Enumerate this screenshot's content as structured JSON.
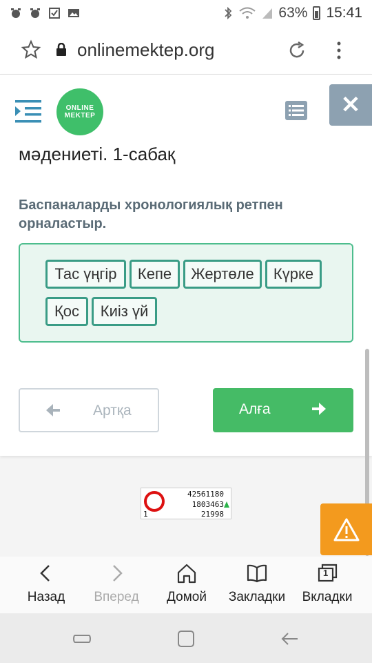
{
  "status": {
    "battery": "63%",
    "time": "15:41",
    "icons": [
      "alarm-icon",
      "alarm-icon",
      "checkbox-icon",
      "image-icon",
      "bluetooth-icon",
      "wifi-icon",
      "signal-icon",
      "battery-icon"
    ]
  },
  "browser": {
    "url": "onlinemektep.org"
  },
  "header": {
    "logo_line1": "ONLINE",
    "logo_line2": "MEKTEP"
  },
  "lesson": {
    "title": "мәдениеті. 1-сабақ",
    "question": "Баспаналарды хронологиялық ретпен орналастыр."
  },
  "chips": [
    "Тас үңгір",
    "Кепе",
    "Жертөле",
    "Күрке",
    "Қос",
    "Киіз үй"
  ],
  "buttons": {
    "back_label": "Артқа",
    "next_label": "Алға"
  },
  "counter": {
    "total": "42561180",
    "today": "1803463",
    "online_prefix": "1",
    "online": "21998"
  },
  "bottom_nav": {
    "back": "Назад",
    "forward": "Вперед",
    "home": "Домой",
    "bookmarks": "Закладки",
    "tabs": "Вкладки",
    "tabs_count": "1"
  },
  "colors": {
    "accent_green": "#45bb66",
    "chip_border": "#3a9c86",
    "box_bg": "#e9f6f0",
    "warning": "#f39a1e",
    "close_bg": "#8da1b1"
  }
}
